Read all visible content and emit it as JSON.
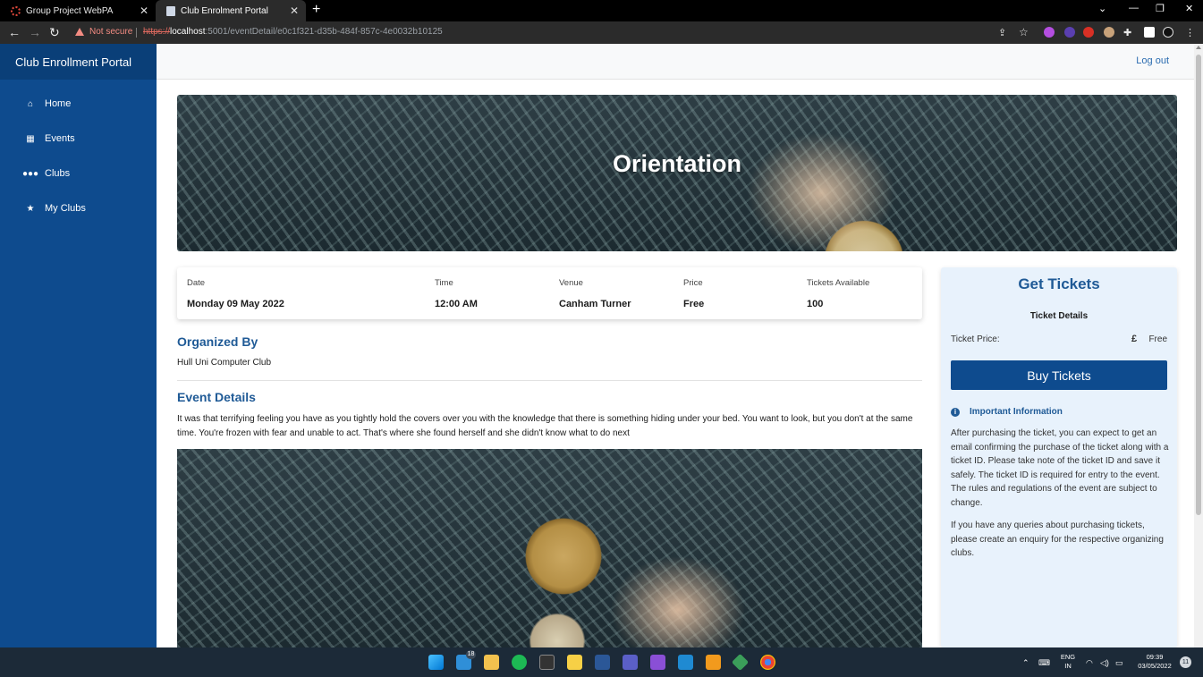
{
  "browser": {
    "tabs": [
      {
        "title": "Group Project WebPA"
      },
      {
        "title": "Club Enrolment Portal"
      }
    ],
    "security_label": "Not secure",
    "url_scheme": "https://",
    "url_host": "localhost",
    "url_rest": ":5001/eventDetail/e0c1f321-d35b-484f-857c-4e0032b10125"
  },
  "sidebar": {
    "brand": "Club Enrollment Portal",
    "items": [
      {
        "label": "Home",
        "icon": "home-icon"
      },
      {
        "label": "Events",
        "icon": "calendar-icon"
      },
      {
        "label": "Clubs",
        "icon": "users-icon"
      },
      {
        "label": "My Clubs",
        "icon": "star-icon"
      }
    ]
  },
  "header": {
    "logout": "Log out"
  },
  "event": {
    "title": "Orientation",
    "date_label": "Date",
    "date": "Monday 09 May 2022",
    "time_label": "Time",
    "time": "12:00 AM",
    "venue_label": "Venue",
    "venue": "Canham Turner",
    "price_label": "Price",
    "price": "Free",
    "tickets_label": "Tickets Available",
    "tickets": "100",
    "organized_heading": "Organized By",
    "organizer": "Hull Uni Computer Club",
    "details_heading": "Event Details",
    "details_text": "It was that terrifying feeling you have as you tightly hold the covers over you with the knowledge that there is something hiding under your bed. You want to look, but you don't at the same time. You're frozen with fear and unable to act. That's where she found herself and she didn't know what to do next"
  },
  "tickets_panel": {
    "title": "Get Tickets",
    "subtitle": "Ticket Details",
    "price_label": "Ticket Price:",
    "currency": "£",
    "price_value": "Free",
    "buy_label": "Buy Tickets",
    "important_title": "Important Information",
    "paragraph1": "After purchasing the ticket, you can expect to get an email confirming the purchase of the ticket along with a ticket ID. Please take note of the ticket ID and save it safely. The ticket ID is required for entry to the event. The rules and regulations of the event are subject to change.",
    "paragraph2": "If you have any queries about purchasing tickets, please create an enquiry for the respective organizing clubs."
  },
  "taskbar": {
    "mail_badge": "18",
    "language": "ENG",
    "region": "IN",
    "time": "09:39",
    "date": "03/05/2022",
    "notifications": "11"
  },
  "colors": {
    "sidebar": "#0e4b8e",
    "brand": "#0a3f78",
    "accent": "#1f5a96",
    "tickets_panel_bg": "#e8f2fc",
    "link": "#2b6cb0"
  }
}
